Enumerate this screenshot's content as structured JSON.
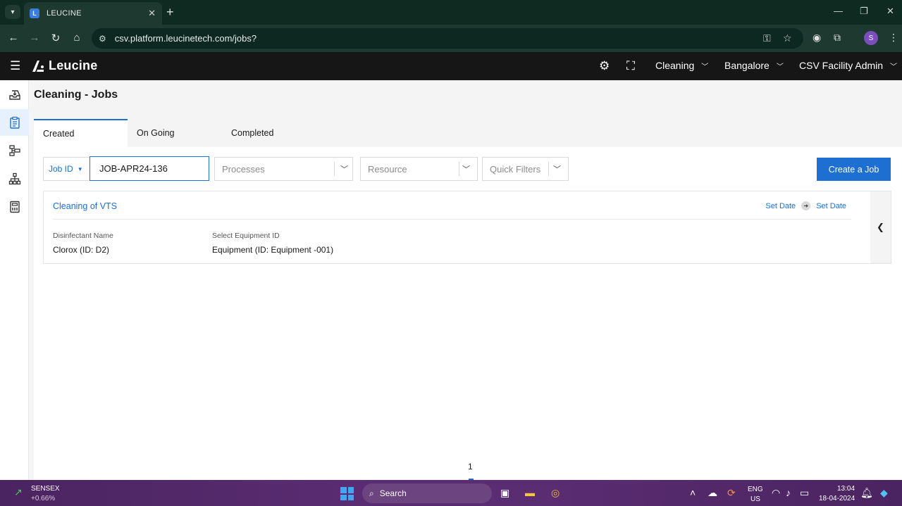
{
  "browser": {
    "tab_title": "LEUCINE",
    "tab_favicon_letter": "L",
    "url": "csv.platform.leucinetech.com/jobs?",
    "profile_initial": "S"
  },
  "header": {
    "brand": "Leucine",
    "use_case": "Cleaning",
    "facility": "Bangalore",
    "user_role": "CSV Facility Admin"
  },
  "page": {
    "title": "Cleaning - Jobs",
    "tabs": [
      {
        "label": "Created"
      },
      {
        "label": "On Going"
      },
      {
        "label": "Completed"
      }
    ],
    "active_tab": "Created"
  },
  "filters": {
    "type_label": "Job ID",
    "search_value": "JOB-APR24-136",
    "processes_placeholder": "Processes",
    "resource_placeholder": "Resource",
    "quick_filters_placeholder": "Quick Filters",
    "create_button": "Create a Job"
  },
  "job": {
    "name": "Cleaning of VTS",
    "start_date": "Set Date",
    "end_date": "Set Date",
    "properties": [
      {
        "label": "Disinfectant Name",
        "value": "Clorox (ID: D2)"
      },
      {
        "label": "Select Equipment ID",
        "value": "Equipment (ID: Equipment -001)"
      }
    ]
  },
  "pagination": {
    "current_page": "1"
  },
  "taskbar": {
    "ticker_name": "SENSEX",
    "ticker_change": "+0.66%",
    "search_label": "Search",
    "lang_top": "ENG",
    "lang_bottom": "US",
    "time": "13:04",
    "date": "18-04-2024"
  },
  "colors": {
    "accent": "#1d6fd1",
    "header_bg": "#161616",
    "browser_bg": "#1e3a30",
    "taskbar_bg": "#5a2c72"
  }
}
